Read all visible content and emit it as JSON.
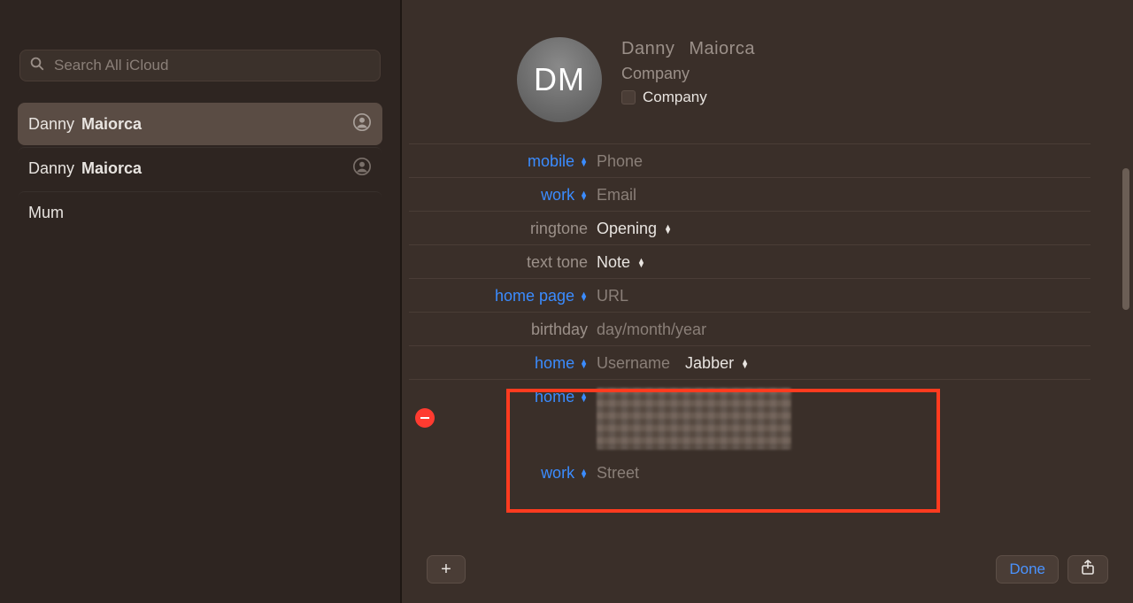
{
  "search": {
    "placeholder": "Search All iCloud"
  },
  "contacts": [
    {
      "first": "Danny",
      "last": "Maiorca",
      "selected": true,
      "silhouette": true
    },
    {
      "first": "Danny",
      "last": "Maiorca",
      "selected": false,
      "silhouette": true
    },
    {
      "first": "Mum",
      "last": "",
      "selected": false,
      "silhouette": false
    }
  ],
  "card": {
    "initials": "DM",
    "first": "Danny",
    "last": "Maiorca",
    "company_placeholder": "Company",
    "company_checkbox_label": "Company"
  },
  "fields": {
    "mobile_label": "mobile",
    "mobile_placeholder": "Phone",
    "work_email_label": "work",
    "work_email_placeholder": "Email",
    "ringtone_label": "ringtone",
    "ringtone_value": "Opening",
    "texttone_label": "text tone",
    "texttone_value": "Note",
    "homepage_label": "home page",
    "homepage_placeholder": "URL",
    "birthday_label": "birthday",
    "birthday_placeholder": "day/month/year",
    "im_label": "home",
    "im_placeholder": "Username",
    "im_service": "Jabber",
    "addr_home_label": "home",
    "addr_work_label": "work",
    "addr_work_placeholder": "Street"
  },
  "footer": {
    "add": "+",
    "done": "Done"
  }
}
